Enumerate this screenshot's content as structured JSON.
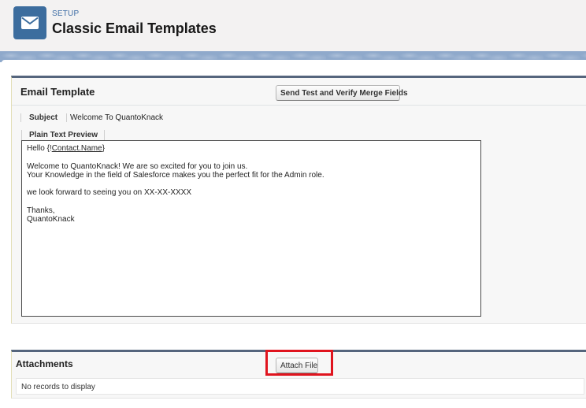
{
  "header": {
    "eyebrow": "SETUP",
    "title": "Classic Email Templates",
    "icon": "envelope-icon",
    "icon_color": "#3c6d9e"
  },
  "email_template": {
    "section_title": "Email Template",
    "send_test_button": "Send Test and Verify Merge Fields",
    "subject_label": "Subject",
    "subject_value": "Welcome To QuantoKnack",
    "preview_label": "Plain Text Preview",
    "body_lines": {
      "greeting_prefix": "Hello {!",
      "merge_field": "Contact.Name",
      "greeting_suffix": "}",
      "line2": "",
      "line3": "Welcome to QuantoKnack! We are so excited for you to join us.",
      "line4": "Your Knowledge in the field of Salesforce makes you the perfect fit for the Admin role.",
      "line5": "",
      "line6": "we look forward to seeing you on XX-XX-XXXX",
      "line7": "",
      "line8": "Thanks,",
      "line9": "QuantoKnack"
    }
  },
  "attachments": {
    "section_title": "Attachments",
    "attach_button": "Attach File",
    "empty_message": "No records to display",
    "highlight_color": "#e0141e"
  }
}
